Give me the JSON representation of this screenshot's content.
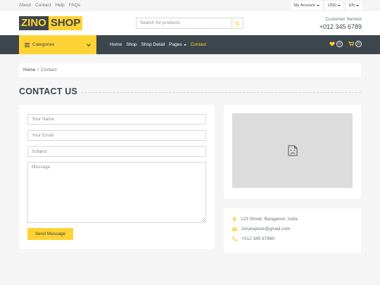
{
  "topbar": {
    "links": [
      "About",
      "Contact",
      "Help",
      "FAQs"
    ],
    "account": "My Account",
    "currency": "USD",
    "language": "EN"
  },
  "header": {
    "logo_part1": "ZINO",
    "logo_part2": "SHOP",
    "search_placeholder": "Search for products",
    "service_title": "Customer Service",
    "service_phone": "+012 345 6789"
  },
  "nav": {
    "categories_label": "Categories",
    "menu": [
      "Home",
      "Shop",
      "Shop Detail",
      "Pages",
      "Contact"
    ],
    "wishlist_count": "0",
    "cart_count": "0"
  },
  "breadcrumb": {
    "home": "Home",
    "separator": "/",
    "current": "Contact"
  },
  "section_title": "CONTACT US",
  "form": {
    "name_placeholder": "Your Name",
    "email_placeholder": "Your Email",
    "subject_placeholder": "Subject",
    "message_placeholder": "Message",
    "send_label": "Send Message"
  },
  "contact_info": {
    "address": "123 Street, Bangalore, India",
    "email": "zinoexplore@gmail.com",
    "phone": "+012 345 67890"
  },
  "colors": {
    "accent": "#ffd333",
    "dark": "#3d464d",
    "background": "#f5f5f5"
  },
  "icons": {
    "search": "search-icon",
    "heart": "heart-icon",
    "cart": "cart-icon",
    "menu": "bars-icon",
    "broken_image": "broken-image-icon",
    "location": "map-marker-icon",
    "envelope": "envelope-icon",
    "phone": "phone-icon"
  }
}
